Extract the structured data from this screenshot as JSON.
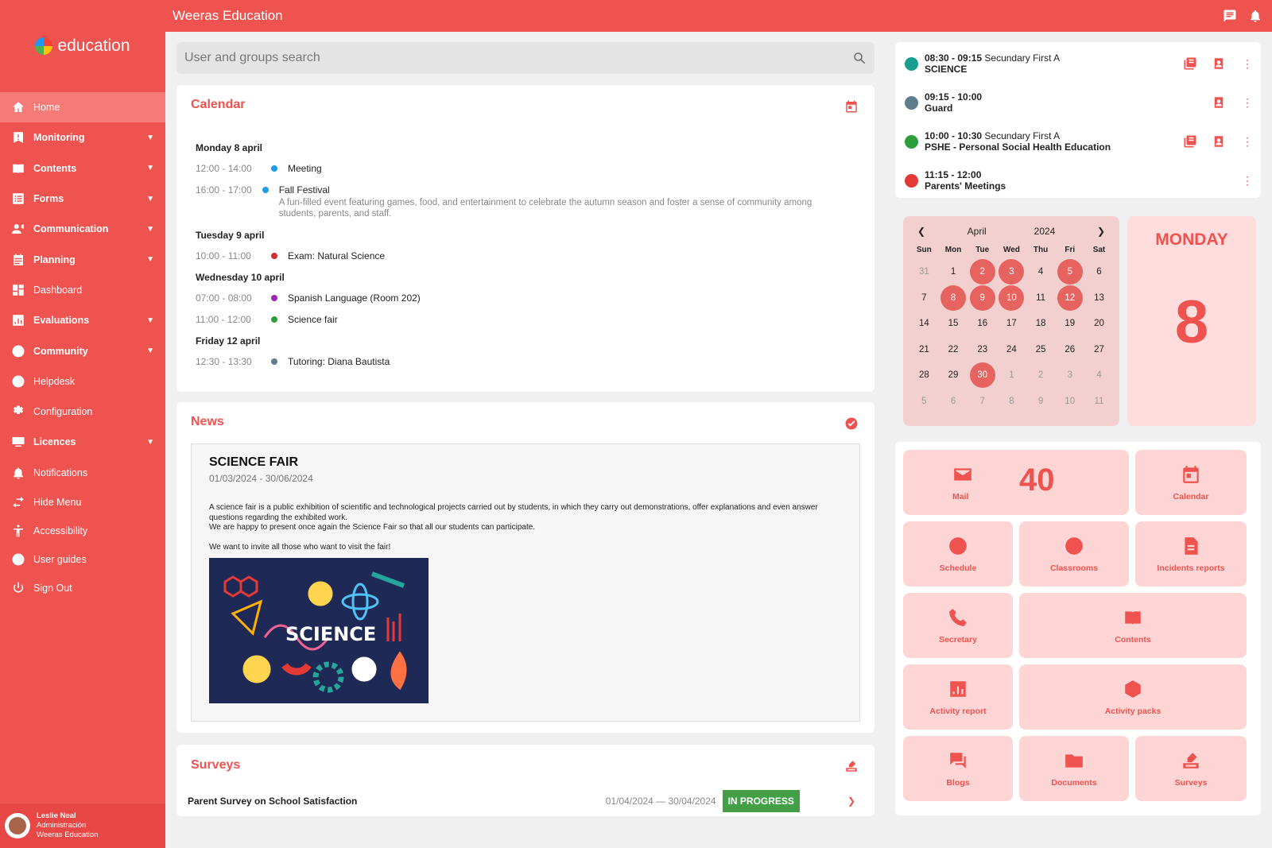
{
  "app": {
    "brand": "education",
    "title": "Weeras Education"
  },
  "sidebar": {
    "items": [
      {
        "label": "Home",
        "icon": "home-icon",
        "active": true,
        "expandable": false
      },
      {
        "label": "Monitoring",
        "icon": "alert-icon",
        "expandable": true
      },
      {
        "label": "Contents",
        "icon": "book-icon",
        "expandable": true
      },
      {
        "label": "Forms",
        "icon": "form-icon",
        "expandable": true
      },
      {
        "label": "Communication",
        "icon": "people-icon",
        "expandable": true
      },
      {
        "label": "Planning",
        "icon": "planner-icon",
        "expandable": true
      },
      {
        "label": "Dashboard",
        "icon": "dashboard-icon",
        "expandable": false
      },
      {
        "label": "Evaluations",
        "icon": "chart-icon",
        "expandable": true
      },
      {
        "label": "Community",
        "icon": "community-icon",
        "expandable": true
      },
      {
        "label": "Helpdesk",
        "icon": "lifebuoy-icon",
        "expandable": false
      },
      {
        "label": "Configuration",
        "icon": "gear-icon",
        "expandable": false
      },
      {
        "label": "Licences",
        "icon": "licence-icon",
        "expandable": true
      },
      {
        "label": "Notifications",
        "icon": "bell-icon",
        "expandable": false
      },
      {
        "label": "Hide Menu",
        "icon": "swap-icon",
        "expandable": false
      },
      {
        "label": "Accessibility",
        "icon": "accessibility-icon",
        "expandable": false
      },
      {
        "label": "User guides",
        "icon": "help-icon",
        "expandable": false
      },
      {
        "label": "Sign Out",
        "icon": "power-icon",
        "expandable": false
      }
    ]
  },
  "user": {
    "name": "Leslie Neal",
    "role": "Administración",
    "org": "Weeras Education"
  },
  "search": {
    "placeholder": "User and groups search"
  },
  "calendar": {
    "title": "Calendar",
    "days": [
      {
        "label": "Monday 8 april",
        "events": [
          {
            "time": "12:00 - 14:00",
            "color": "#1e9be9",
            "title": "Meeting"
          },
          {
            "time": "16:00 - 17:00",
            "color": "#1e9be9",
            "title": "Fall Festival",
            "desc": "A fun-filled event featuring games, food, and entertainment to celebrate the autumn season and foster a sense of community among students, parents, and staff."
          }
        ]
      },
      {
        "label": "Tuesday 9 april",
        "events": [
          {
            "time": "10:00 - 11:00",
            "color": "#d32f2f",
            "title": "Exam: Natural Science"
          }
        ]
      },
      {
        "label": "Wednesday 10 april",
        "events": [
          {
            "time": "07:00 - 08:00",
            "color": "#9c27b0",
            "title": "Spanish Language (Room 202)"
          },
          {
            "time": "11:00 - 12:00",
            "color": "#2e9e3c",
            "title": "Science fair"
          }
        ]
      },
      {
        "label": "Friday 12 april",
        "events": [
          {
            "time": "12:30 - 13:30",
            "color": "#607d8b",
            "title": "Tutoring: Diana Bautista"
          }
        ]
      }
    ]
  },
  "news": {
    "title": "News",
    "item": {
      "heading": "SCIENCE FAIR",
      "dates": "01/03/2024 - 30/06/2024",
      "p1": "A science fair is a public exhibition of scientific and technological projects carried out by students, in which they carry out demonstrations, offer explanations and even answer questions regarding the exhibited work.",
      "p2": "We are happy to present once again the Science Fair so that all our students can participate.",
      "p3": "We want to invite all those who want to visit the fair!",
      "image_text": "SCIENCE"
    }
  },
  "surveys": {
    "title": "Surveys",
    "item": {
      "name": "Parent Survey on School Satisfaction",
      "dates": "01/04/2024 — 30/04/2024",
      "status": "IN PROGRESS"
    }
  },
  "schedule": [
    {
      "time": "08:30 - 09:15",
      "group": "Secundary First A",
      "subject": "SCIENCE",
      "color": "#179e8e",
      "actions": 3
    },
    {
      "time": "09:15 - 10:00",
      "group": "",
      "subject": "Guard",
      "color": "#607d8b",
      "actions": 2
    },
    {
      "time": "10:00 - 10:30",
      "group": "Secundary First A",
      "subject": "PSHE - Personal Social Health Education",
      "color": "#2e9e3c",
      "actions": 3
    },
    {
      "time": "11:15 - 12:00",
      "group": "",
      "subject": "Parents' Meetings",
      "color": "#e53935",
      "actions": 1
    }
  ],
  "minical": {
    "month": "April",
    "year": "2024",
    "weekdays": [
      "Sun",
      "Mon",
      "Tue",
      "Wed",
      "Thu",
      "Fri",
      "Sat"
    ],
    "weeks": [
      [
        "31",
        "1",
        "2",
        "3",
        "4",
        "5",
        "6"
      ],
      [
        "7",
        "8",
        "9",
        "10",
        "11",
        "12",
        "13"
      ],
      [
        "14",
        "15",
        "16",
        "17",
        "18",
        "19",
        "20"
      ],
      [
        "21",
        "22",
        "23",
        "24",
        "25",
        "26",
        "27"
      ],
      [
        "28",
        "29",
        "30",
        "1",
        "2",
        "3",
        "4"
      ],
      [
        "5",
        "6",
        "7",
        "8",
        "9",
        "10",
        "11"
      ]
    ],
    "highlighted": [
      "0-2",
      "0-3",
      "0-5",
      "1-1",
      "1-2",
      "1-3",
      "1-5",
      "4-2"
    ],
    "other_month": [
      "0-0",
      "4-3",
      "4-4",
      "4-5",
      "4-6",
      "5-0",
      "5-1",
      "5-2",
      "5-3",
      "5-4",
      "5-5",
      "5-6"
    ]
  },
  "today": {
    "weekday": "MONDAY",
    "day": "8"
  },
  "tiles": [
    {
      "label": "Mail",
      "icon": "mail-icon",
      "count": "40"
    },
    {
      "label": "Calendar",
      "icon": "calendar-icon"
    },
    {
      "label": "Schedule",
      "icon": "clock-icon"
    },
    {
      "label": "Classrooms",
      "icon": "classrooms-icon"
    },
    {
      "label": "Incidents reports",
      "icon": "document-icon"
    },
    {
      "label": "Secretary",
      "icon": "phone-icon"
    },
    {
      "label": "Contents",
      "icon": "book-icon"
    },
    {
      "label": "Activity report",
      "icon": "bar-chart-icon"
    },
    {
      "label": "Activity packs",
      "icon": "package-icon"
    },
    {
      "label": "Blogs",
      "icon": "chat-icon"
    },
    {
      "label": "Documents",
      "icon": "folder-icon"
    },
    {
      "label": "Surveys",
      "icon": "survey-icon"
    }
  ]
}
